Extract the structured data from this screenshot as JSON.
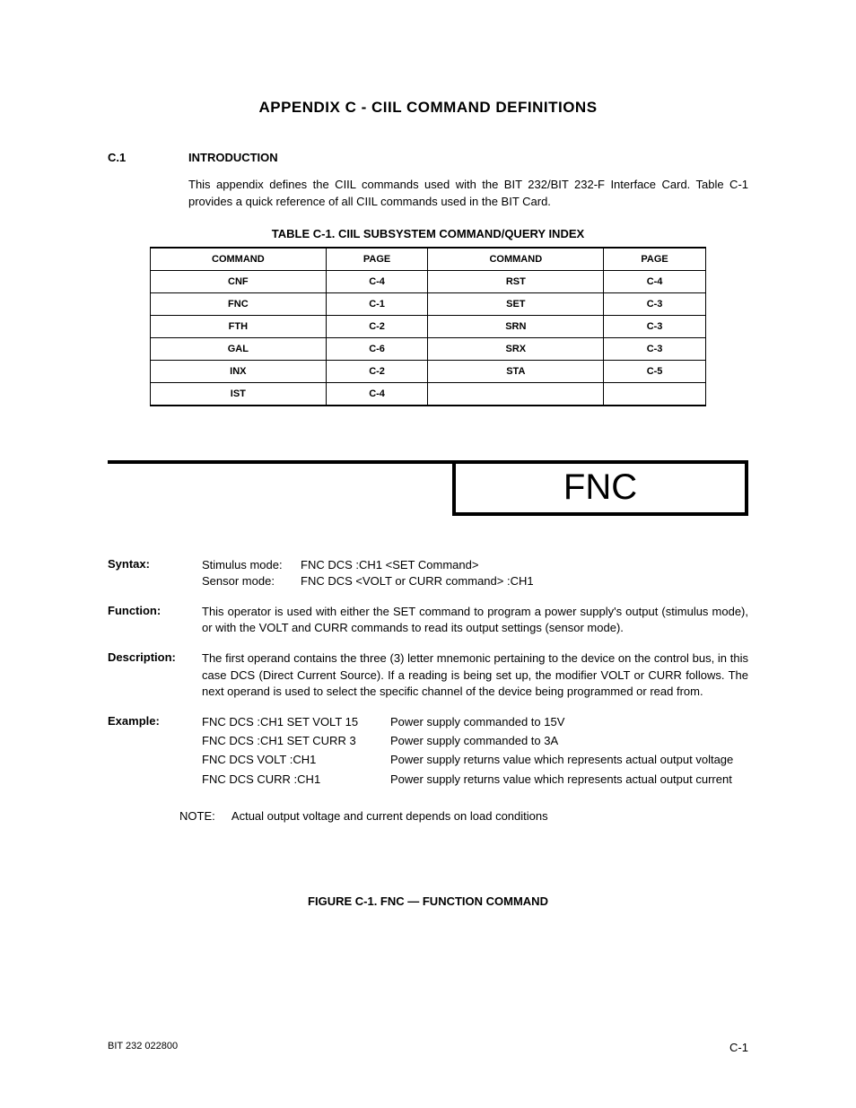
{
  "title": "APPENDIX C  -  CIIL COMMAND DEFINITIONS",
  "section": {
    "num": "C.1",
    "heading": "INTRODUCTION"
  },
  "intro": "This appendix defines the CIIL commands used with the BIT 232/BIT 232-F Interface Card. Table C-1 provides a quick reference of all CIIL commands used in the BIT Card.",
  "table": {
    "caption": "TABLE C-1.  CIIL SUBSYSTEM COMMAND/QUERY INDEX",
    "headers": [
      "COMMAND",
      "PAGE",
      "COMMAND",
      "PAGE"
    ],
    "rows": [
      [
        "CNF",
        "C-4",
        "RST",
        "C-4"
      ],
      [
        "FNC",
        "C-1",
        "SET",
        "C-3"
      ],
      [
        "FTH",
        "C-2",
        "SRN",
        "C-3"
      ],
      [
        "GAL",
        "C-6",
        "SRX",
        "C-3"
      ],
      [
        "INX",
        "C-2",
        "STA",
        "C-5"
      ],
      [
        "IST",
        "C-4",
        "",
        ""
      ]
    ]
  },
  "fnc": {
    "box_label": "FNC",
    "syntax": {
      "label": "Syntax:",
      "lines": [
        {
          "mode": "Stimulus mode:",
          "value": "FNC DCS :CH1 <SET Command>"
        },
        {
          "mode": "Sensor mode:",
          "value": "FNC DCS <VOLT or CURR command> :CH1"
        }
      ]
    },
    "function": {
      "label": "Function:",
      "text": "This operator is used with either the SET command to program a power supply's output (stimulus mode), or with the VOLT and CURR commands to read its output settings (sensor mode)."
    },
    "description": {
      "label": "Description:",
      "text": "The first operand contains the three (3) letter mnemonic pertaining to the device on the control bus, in this case DCS (Direct Current Source). If a reading is being set up, the modifier VOLT or CURR follows. The next operand is used to select the specific channel of the device being programmed or read from."
    },
    "example": {
      "label": "Example:",
      "rows": [
        {
          "cmd": "FNC DCS :CH1 SET VOLT 15",
          "desc": "Power supply commanded to 15V"
        },
        {
          "cmd": "FNC DCS :CH1 SET CURR 3",
          "desc": "Power supply commanded to 3A"
        },
        {
          "cmd": "FNC DCS VOLT :CH1",
          "desc": "Power supply returns value which represents actual output voltage"
        },
        {
          "cmd": "FNC DCS CURR :CH1",
          "desc": "Power supply returns value which represents actual output current"
        }
      ]
    },
    "note": {
      "label": "NOTE:",
      "text": "Actual output voltage and current depends on load conditions"
    },
    "figure_caption": "FIGURE C-1.    FNC — FUNCTION COMMAND"
  },
  "footer": {
    "left": "BIT 232 022800",
    "right": "C-1"
  }
}
